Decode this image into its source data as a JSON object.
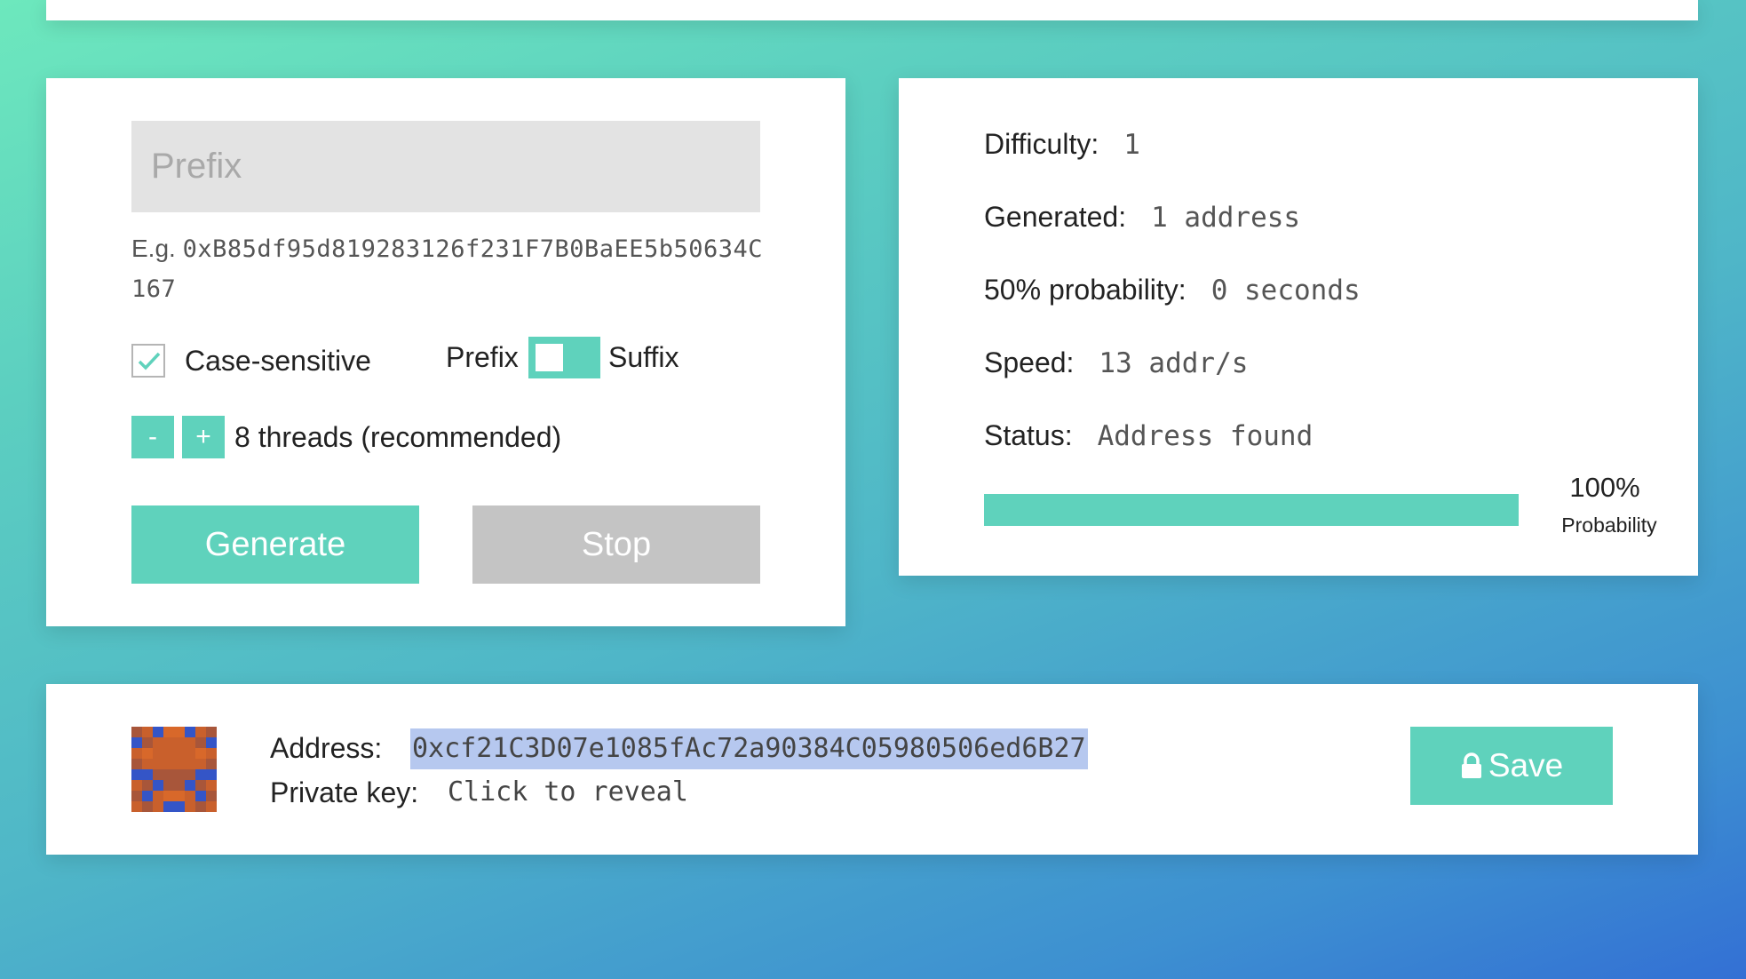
{
  "settings": {
    "prefix_placeholder": "Prefix",
    "example_label": "E.g.",
    "example_address": "0xB85df95d819283126f231F7B0BaEE5b50634C167",
    "case_sensitive_label": "Case-sensitive",
    "case_sensitive_checked": true,
    "toggle_left_label": "Prefix",
    "toggle_right_label": "Suffix",
    "minus_label": "-",
    "plus_label": "+",
    "threads_label": "8 threads (recommended)",
    "generate_label": "Generate",
    "stop_label": "Stop"
  },
  "stats": {
    "difficulty_label": "Difficulty:",
    "difficulty_value": "1",
    "generated_label": "Generated:",
    "generated_value": "1 address",
    "probability50_label": "50% probability:",
    "probability50_value": "0 seconds",
    "speed_label": "Speed:",
    "speed_value": "13 addr/s",
    "status_label": "Status:",
    "status_value": "Address found",
    "progress_percent_text": "100%",
    "progress_fraction": 1.0,
    "progress_caption": "Probability"
  },
  "result": {
    "address_label": "Address:",
    "address_value": "0xcf21C3D07e1085fAc72a90384C05980506ed6B27",
    "private_key_label": "Private key:",
    "private_key_value": "Click to reveal",
    "save_label": "Save",
    "save_icon": "lock-icon"
  },
  "colors": {
    "accent": "#5fd2bc",
    "disabled": "#c4c4c4",
    "selection": "#b6c8ef",
    "identicon": [
      "#a8563a",
      "#c9602c",
      "#3455c7",
      "#d8682a"
    ]
  }
}
